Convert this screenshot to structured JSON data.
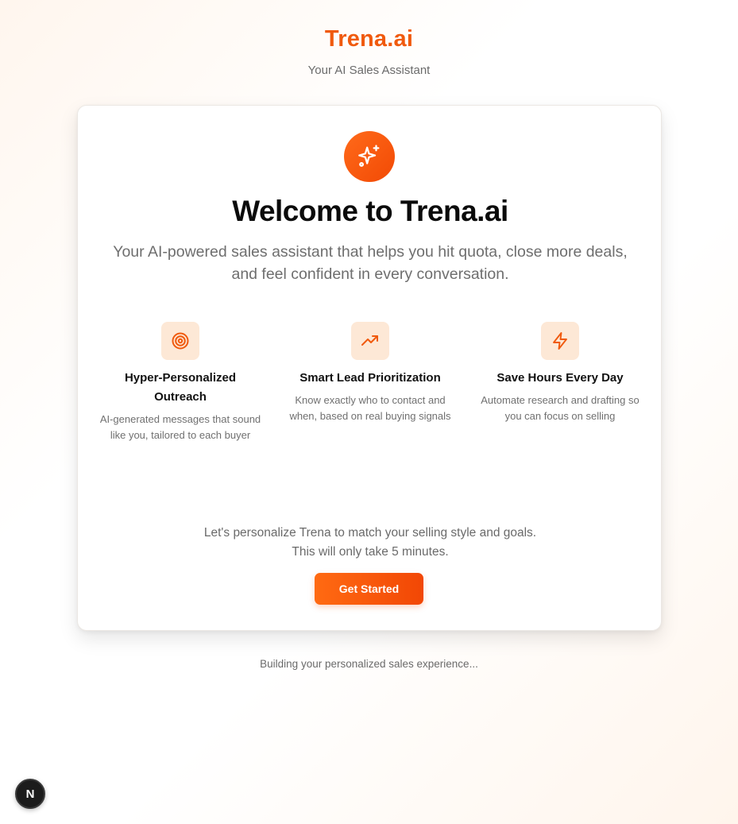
{
  "header": {
    "brand": "Trena.ai",
    "tagline": "Your AI Sales Assistant"
  },
  "card": {
    "hero_icon": "sparkles-icon",
    "title": "Welcome to Trena.ai",
    "intro": "Your AI-powered sales assistant that helps you hit quota, close more deals, and feel confident in every conversation.",
    "features": [
      {
        "icon": "target-icon",
        "title": "Hyper-Personalized Outreach",
        "description": "AI-generated messages that sound like you, tailored to each buyer"
      },
      {
        "icon": "trending-up-icon",
        "title": "Smart Lead Prioritization",
        "description": "Know exactly who to contact and when, based on real buying signals"
      },
      {
        "icon": "lightning-bolt-icon",
        "title": "Save Hours Every Day",
        "description": "Automate research and drafting so you can focus on selling"
      }
    ],
    "personalize_line1": "Let's personalize Trena to match your selling style and goals.",
    "personalize_line2": "This will only take 5 minutes.",
    "cta_label": "Get Started"
  },
  "footer": {
    "note": "Building your personalized sales experience..."
  },
  "dev_badge": {
    "label": "N"
  },
  "colors": {
    "accent": "#f05a0e",
    "accent_dark": "#f24705",
    "icon_tile": "#fde8d6"
  }
}
